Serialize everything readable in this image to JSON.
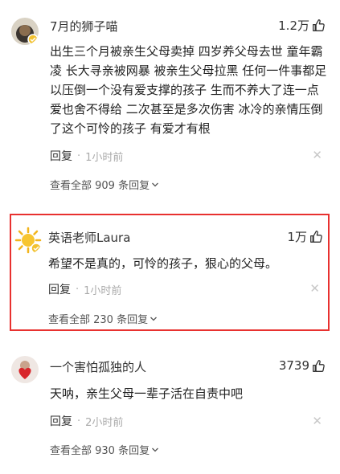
{
  "comments": [
    {
      "username": "7月的狮子喵",
      "likes": "1.2万",
      "text": "出生三个月被亲生父母卖掉 四岁养父母去世 童年霸凌 长大寻亲被网暴 被亲生父母拉黑 任何一件事都足以压倒一个没有爱支撑的孩子 生而不养大了连一点爱也舍不得给 二次甚至是多次伤害 冰冷的亲情压倒了这个可怜的孩子 有爱才有根",
      "reply_label": "回复",
      "dot": "·",
      "time": "1小时前",
      "view_all": "查看全部 909 条回复",
      "avatar_icon": "lion-cat-avatar"
    },
    {
      "username": "英语老师Laura",
      "likes": "1万",
      "text": "希望不是真的，可怜的孩子，狠心的父母。",
      "reply_label": "回复",
      "dot": "·",
      "time": "1小时前",
      "view_all": "查看全部 230 条回复",
      "avatar_icon": "sun-avatar"
    },
    {
      "username": "一个害怕孤独的人",
      "likes": "3739",
      "text": "天呐，亲生父母一辈子活在自责中吧",
      "reply_label": "回复",
      "dot": "·",
      "time": "2小时前",
      "view_all": "查看全部 930 条回复",
      "avatar_icon": "heart-avatar"
    }
  ],
  "colors": {
    "highlight_border": "#e8312f",
    "muted": "#aaaaaa"
  }
}
